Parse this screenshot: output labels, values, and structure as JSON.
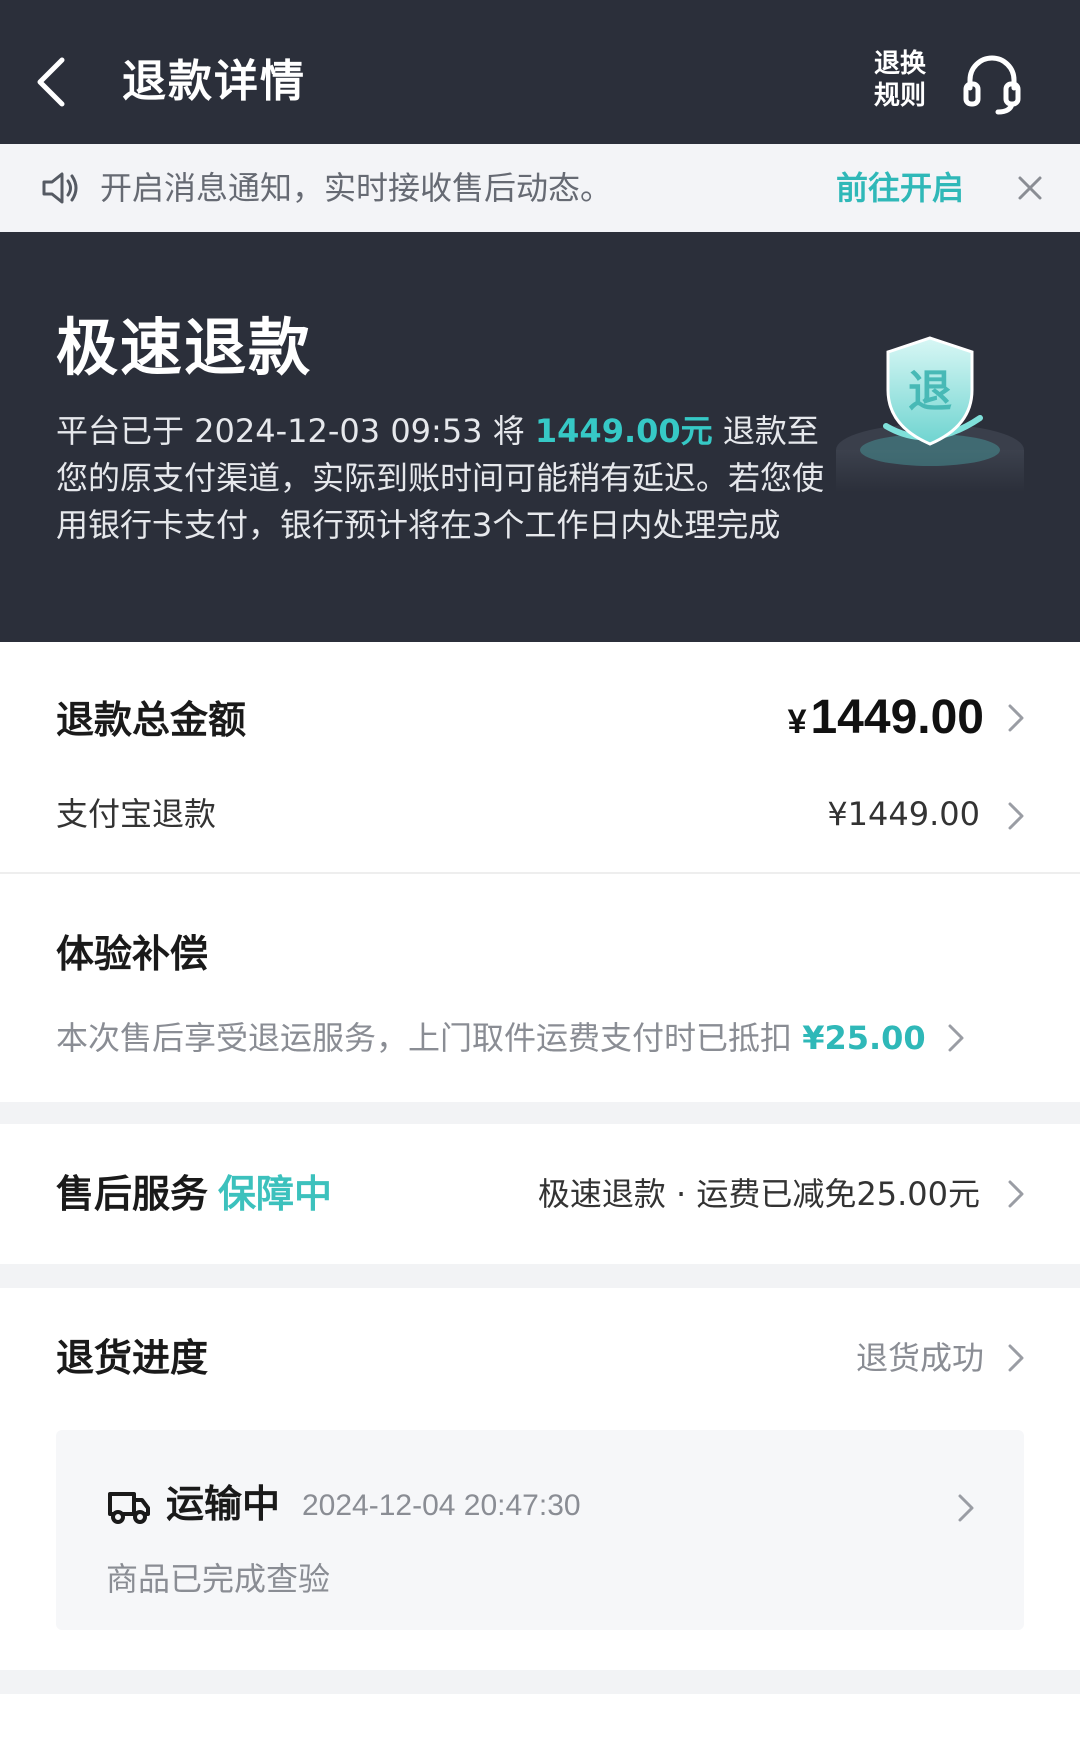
{
  "header": {
    "title": "退款详情",
    "rules_line1": "退换",
    "rules_line2": "规则",
    "back_icon": "chevron-left-icon",
    "service_icon": "headset-icon"
  },
  "notice": {
    "text": "开启消息通知，实时接收售后动态。",
    "action": "前往开启",
    "icon": "speaker-icon",
    "close_icon": "close-icon"
  },
  "hero": {
    "title": "极速退款",
    "desc_prefix": "平台已于 2024-12-03 09:53 将 ",
    "amount": "1449.00元",
    "desc_suffix": " 退款至您的原支付渠道，实际到账时间可能稍有延迟。若您使用银行卡支付，银行预计将在3个工作日内处理完成",
    "badge_char": "退"
  },
  "refund": {
    "total_label": "退款总金额",
    "total_symbol": "¥",
    "total_amount": "1449.00",
    "alipay_label": "支付宝退款",
    "alipay_amount": "¥1449.00"
  },
  "compensation": {
    "title": "体验补偿",
    "desc": "本次售后享受退运服务，上门取件运费支付时已抵扣 ",
    "amount": "¥25.00"
  },
  "service": {
    "title": "售后服务",
    "status": "保障中",
    "detail": "极速退款 · 运费已减免25.00元"
  },
  "progress": {
    "title": "退货进度",
    "status": "退货成功",
    "state": "运输中",
    "time": "2024-12-04 20:47:30",
    "note": "商品已完成查验",
    "icon": "truck-icon"
  },
  "colors": {
    "header_bg": "#2b2f3a",
    "accent": "#2fb8b8",
    "page_bg": "#f2f3f5"
  }
}
